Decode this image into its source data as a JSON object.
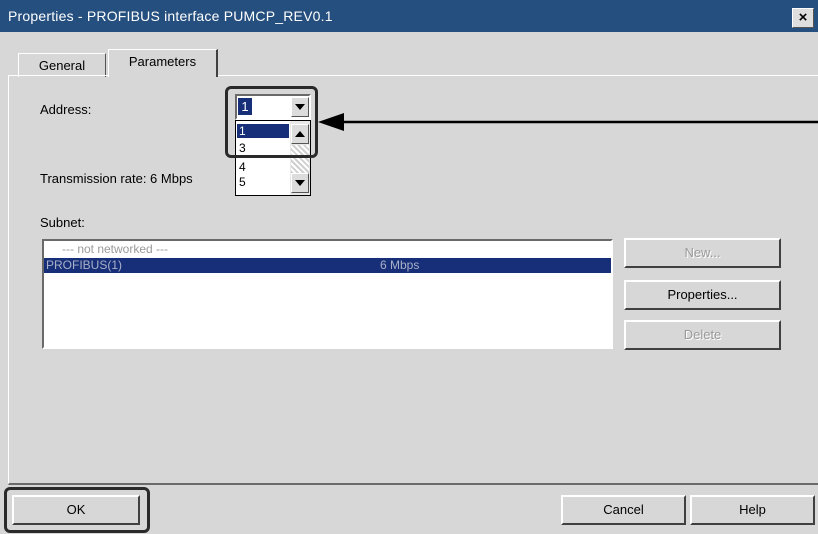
{
  "window": {
    "title": "Properties - PROFIBUS interface  PUMCP_REV0.1",
    "close": "×"
  },
  "tabs": [
    {
      "label": "General",
      "active": false
    },
    {
      "label": "Parameters",
      "active": true
    }
  ],
  "address": {
    "label": "Address:",
    "value": "1",
    "options": [
      "1",
      "3",
      "4",
      "5"
    ],
    "selected_option": "1"
  },
  "transmission": {
    "label": "Transmission rate: 6 Mbps"
  },
  "subnet": {
    "label": "Subnet:",
    "items": [
      {
        "name": "--- not networked ---",
        "rate": "",
        "selected": false
      },
      {
        "name": "PROFIBUS(1)",
        "rate": "6 Mbps",
        "selected": true
      }
    ]
  },
  "side_buttons": {
    "new": "New...",
    "properties": "Properties...",
    "delete": "Delete"
  },
  "footer": {
    "ok": "OK",
    "cancel": "Cancel",
    "help": "Help"
  },
  "colors": {
    "titlebar": "#254f7e",
    "selection": "#162f78",
    "dialog_bg": "#d7d7d7"
  }
}
